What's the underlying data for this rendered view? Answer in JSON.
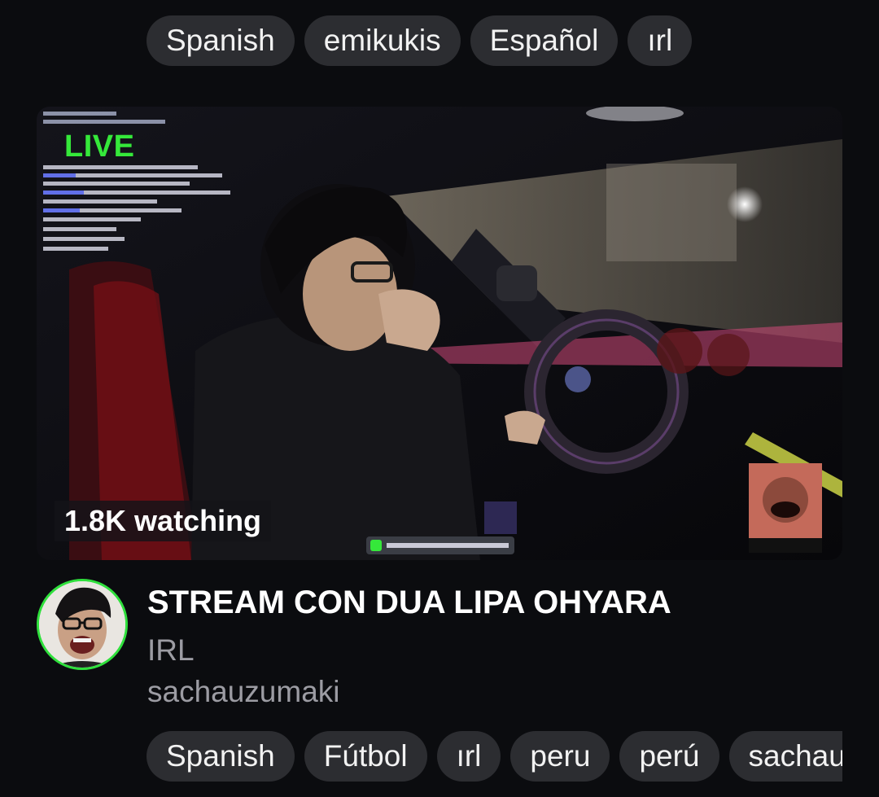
{
  "top_tags": [
    "Spanish",
    "emikukis",
    "Español",
    "ırl"
  ],
  "stream": {
    "live_label": "LIVE",
    "viewers": "1.8K watching",
    "title": "STREAM CON DUA LIPA OHYARA",
    "category": "IRL",
    "channel": "sachauzumaki",
    "thumbnail_description": "streamer drinking in driver seat of car at night",
    "accent_color": "#35e83a"
  },
  "bottom_tags": [
    "Spanish",
    "Fútbol",
    "ırl",
    "peru",
    "perú",
    "sachauzumaki"
  ]
}
